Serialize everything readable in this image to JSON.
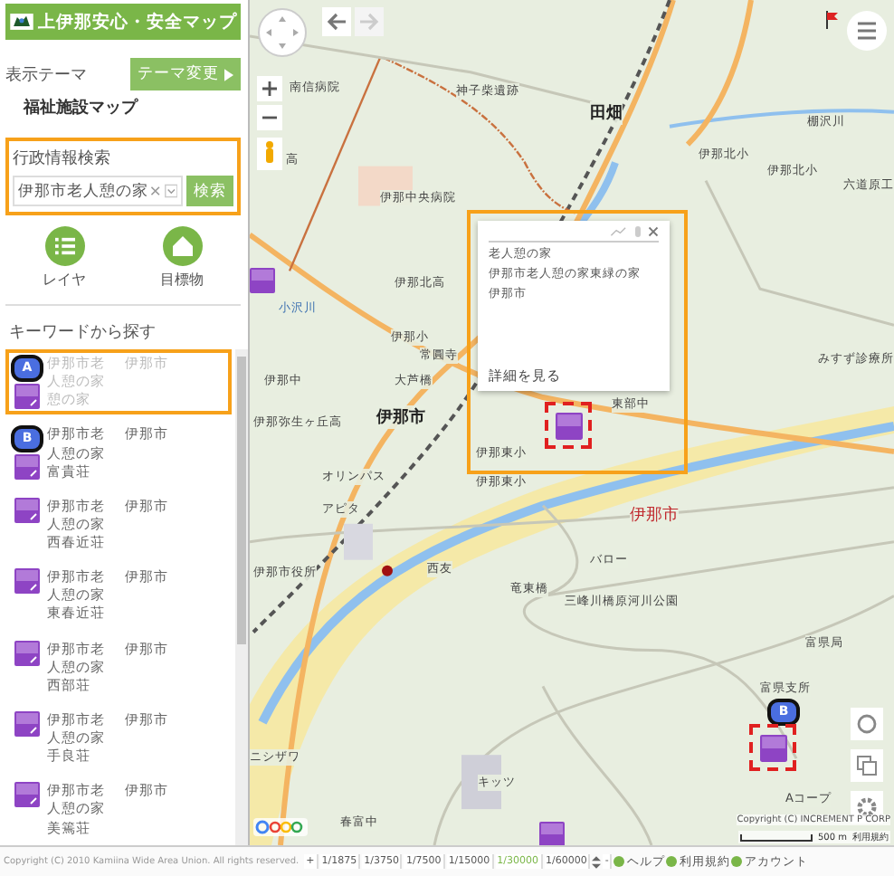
{
  "header": {
    "title": "上伊那安心・安全マップ"
  },
  "theme": {
    "label": "表示テーマ",
    "button": "テーマ変更",
    "name": "福祉施設マップ"
  },
  "search": {
    "label": "行政情報検索",
    "value": "伊那市老人憩の家",
    "button": "検索"
  },
  "tools": [
    {
      "label": "レイヤ",
      "kind": "layer"
    },
    {
      "label": "目標物",
      "kind": "landmark"
    }
  ],
  "keyword_heading": "キーワードから探す",
  "results": [
    {
      "name": "伊那市老人憩の家憩の家",
      "city": "伊那市",
      "marker": "A",
      "selected": true
    },
    {
      "name": "伊那市老人憩の家富貴荘",
      "city": "伊那市",
      "marker": "B",
      "selected": false
    },
    {
      "name": "伊那市老人憩の家西春近荘",
      "city": "伊那市",
      "selected": false
    },
    {
      "name": "伊那市老人憩の家東春近荘",
      "city": "伊那市",
      "selected": false
    },
    {
      "name": "伊那市老人憩の家西部荘",
      "city": "伊那市",
      "selected": false
    },
    {
      "name": "伊那市老人憩の家手良荘",
      "city": "伊那市",
      "selected": false
    },
    {
      "name": "伊那市老人憩の家美篶荘",
      "city": "伊那市",
      "selected": false
    }
  ],
  "map": {
    "labels": [
      "南信病院",
      "神子柴遺跡",
      "田畑",
      "棚沢川",
      "高",
      "伊那北小",
      "伊那北小",
      "六道原工",
      "伊那中央病院",
      "伊那北高",
      "小沢川",
      "伊那小",
      "常圓寺",
      "みすず診療所",
      "伊那中",
      "大芦橋",
      "伊那市",
      "伊那弥生ヶ丘高",
      "東部中",
      "伊那東小",
      "伊那東小",
      "オリンパス",
      "アピタ",
      "伊那市",
      "伊那市役所",
      "西友",
      "バロー",
      "竜東橋",
      "三峰川橋原河川公園",
      "富県局",
      "富県支所",
      "ニシザワ",
      "キッツ",
      "Aコープ",
      "春富中"
    ],
    "popup": {
      "category": "老人憩の家",
      "name": "伊那市老人憩の家東緑の家",
      "city": "伊那市",
      "link": "詳細を見る"
    },
    "pin_marker": "B",
    "copyright": "Copyright (C) INCREMENT P CORP",
    "scale": "500 m",
    "terms": "利用規約"
  },
  "status_bar": {
    "copyright": "Copyright (C) 2010 Kamiina Wide Area Union. All rights reserved.",
    "zoom_in": "+",
    "scales": [
      {
        "label": "1/1875",
        "selected": false
      },
      {
        "label": "1/3750",
        "selected": false
      },
      {
        "label": "1/7500",
        "selected": false
      },
      {
        "label": "1/15000",
        "selected": false
      },
      {
        "label": "1/30000",
        "selected": true
      },
      {
        "label": "1/60000",
        "selected": false
      }
    ],
    "zoom_out": "-",
    "links": [
      "ヘルプ",
      "利用規約",
      "アカウント"
    ]
  }
}
